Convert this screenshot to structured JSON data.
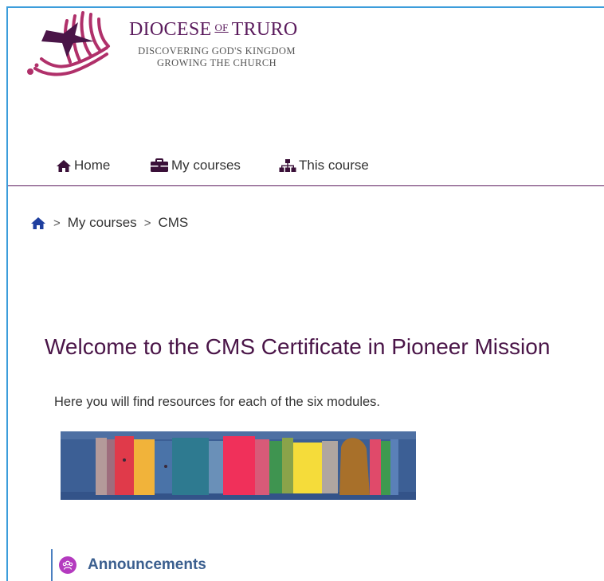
{
  "header": {
    "brand_name_left": "DIOCESE",
    "brand_name_of": "OF",
    "brand_name_right": "TRURO",
    "tagline_line1": "DISCOVERING GOD'S KINGDOM",
    "tagline_line2": "GROWING THE CHURCH"
  },
  "nav": {
    "items": [
      {
        "label": "Home",
        "icon": "home-icon"
      },
      {
        "label": "My courses",
        "icon": "briefcase-icon"
      },
      {
        "label": "This course",
        "icon": "sitemap-icon"
      }
    ]
  },
  "breadcrumb": {
    "home_icon": "home-icon",
    "separator": ">",
    "items": [
      "My courses",
      "CMS"
    ]
  },
  "main": {
    "title": "Welcome to the CMS Certificate in Pioneer Mission",
    "intro": "Here you will find resources for each of the six modules."
  },
  "announcements": {
    "label": "Announcements",
    "icon": "forum-icon"
  },
  "colors": {
    "brand_purple": "#5a1a5c",
    "title_purple": "#4a1548",
    "link_blue": "#3b5f8f",
    "frame_blue": "#3d9ddb",
    "forum_magenta": "#b43abf",
    "breadcrumb_home_blue": "#1f3f9f"
  }
}
